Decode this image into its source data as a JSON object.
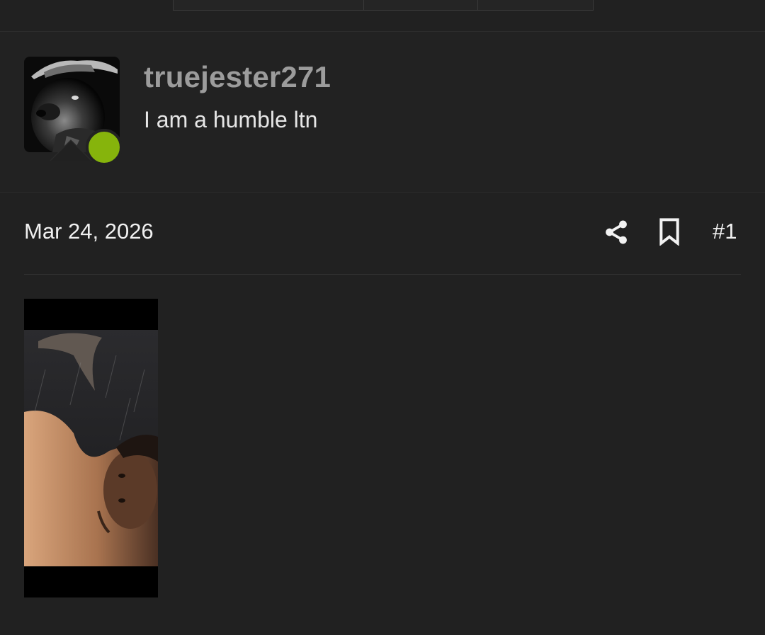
{
  "user": {
    "username": "truejester271",
    "title": "I am a humble ltn",
    "online": true
  },
  "post": {
    "date": "Mar 24, 2026",
    "number": "#1"
  },
  "icons": {
    "share": "share-icon",
    "bookmark": "bookmark-icon"
  },
  "colors": {
    "background": "#212121",
    "online_indicator": "#86b40c",
    "username": "#9c9c9c"
  }
}
